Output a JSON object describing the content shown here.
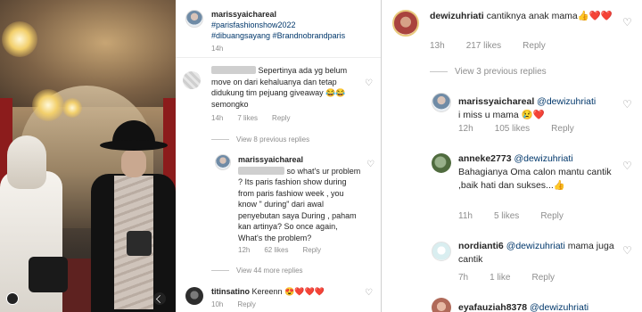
{
  "panel_photo": {
    "icons": {
      "profile": "person-circle-icon",
      "mute": "mute-icon"
    }
  },
  "panel_middle": {
    "post": {
      "username": "marissyaichareal",
      "hashtags": [
        "#parisfashionshow2022",
        "#dibuangsayang #Brandnobrandparis"
      ],
      "time": "14h"
    },
    "comment1": {
      "text": "Sepertinya ada yg belum move on dari kehaluanya dan tetap didukung tim pejuang giveaway 😂😂 semongko",
      "time": "14h",
      "likes": "7 likes",
      "reply": "Reply"
    },
    "view_previous": "View 8 previous replies",
    "reply1": {
      "username": "marissyaichareal",
      "text": "so what's ur problem ? Its paris fashion show during from paris fashiow week , you know \" during\" dari awal penyebutan saya During , paham kan artinya? So once again, What's the problem?",
      "time": "12h",
      "likes": "62 likes",
      "reply": "Reply"
    },
    "view_more": "View 44 more replies",
    "comment2": {
      "username": "titinsatino",
      "text": "Kereenn 😍❤️❤️❤️",
      "time": "10h",
      "reply": "Reply"
    }
  },
  "panel_right": {
    "comment1": {
      "username": "dewizuhriati",
      "text": "cantiknya anak mama👍❤️❤️",
      "time": "13h",
      "likes": "217 likes",
      "reply": "Reply"
    },
    "view_previous": "View 3 previous replies",
    "reply1": {
      "username": "marissyaichareal",
      "mention": "@dewizuhriati",
      "text": "i miss u mama 😢❤️",
      "time": "12h",
      "likes": "105 likes",
      "reply": "Reply"
    },
    "reply2": {
      "username": "anneke2773",
      "mention": "@dewizuhriati",
      "text": "Bahagianya Oma calon mantu cantik ,baik hati dan sukses...👍",
      "time": "11h",
      "likes": "5 likes",
      "reply": "Reply"
    },
    "reply3": {
      "username": "nordianti6",
      "mention": "@dewizuhriati",
      "text": "mama juga cantik",
      "time": "7h",
      "likes": "1 like",
      "reply": "Reply"
    },
    "reply4": {
      "username": "eyafauziah8378",
      "mention": "@dewizuhriati"
    }
  },
  "icons": {
    "like": "heart-outline-icon"
  }
}
